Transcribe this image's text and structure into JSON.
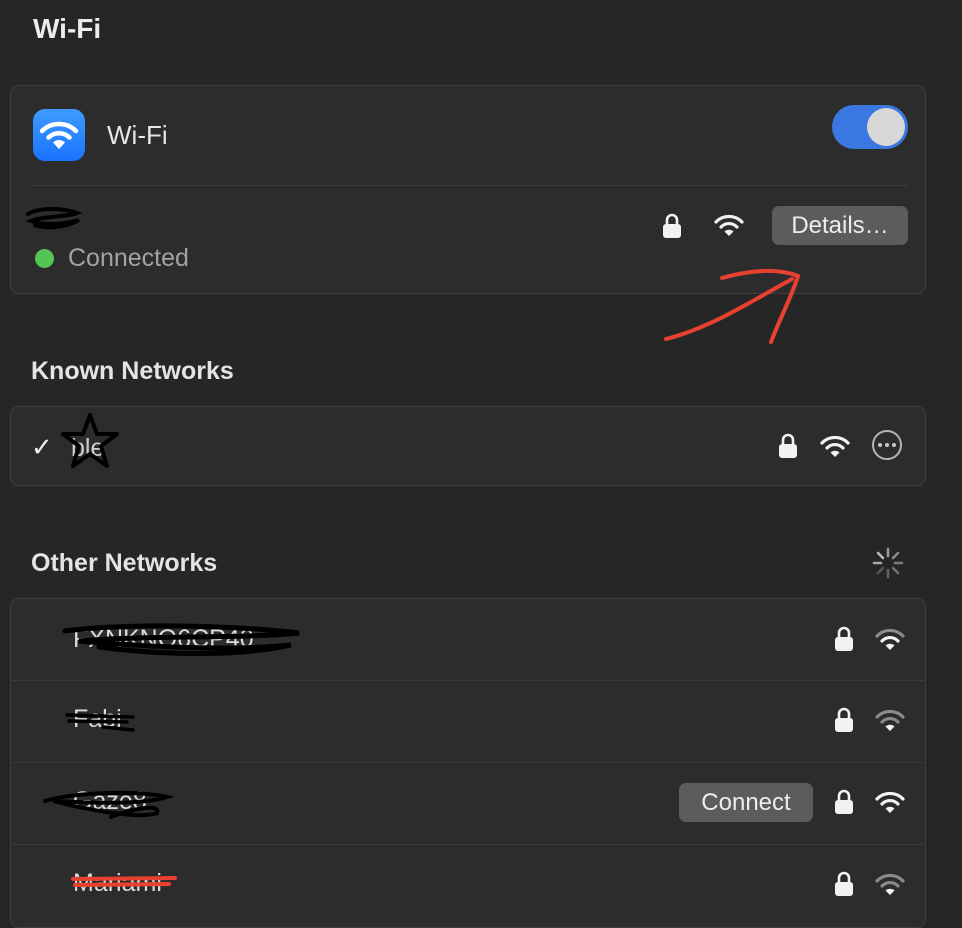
{
  "page_title": "Wi-Fi",
  "wifi": {
    "label": "Wi-Fi",
    "toggle_state": "on",
    "current_network": {
      "status": "Connected",
      "details_label": "Details…"
    }
  },
  "known_networks": {
    "title": "Known Networks",
    "items": [
      {
        "checkmark": "✓",
        "name": "ble"
      }
    ]
  },
  "other_networks": {
    "title": "Other Networks",
    "connect_label": "Connect",
    "items": [
      {
        "name": "FXNKNO6CP40"
      },
      {
        "name": "Fabi"
      },
      {
        "name": "Gaze8"
      },
      {
        "name": "Mariami"
      }
    ]
  },
  "colors": {
    "accent": "#3b77e0",
    "connected": "#54c454",
    "annotation": "#e8412f"
  },
  "icons": [
    "wifi-app-icon",
    "lock-icon",
    "wifi-signal-icon",
    "more-icon",
    "loading-spinner-icon",
    "checkmark-icon"
  ]
}
